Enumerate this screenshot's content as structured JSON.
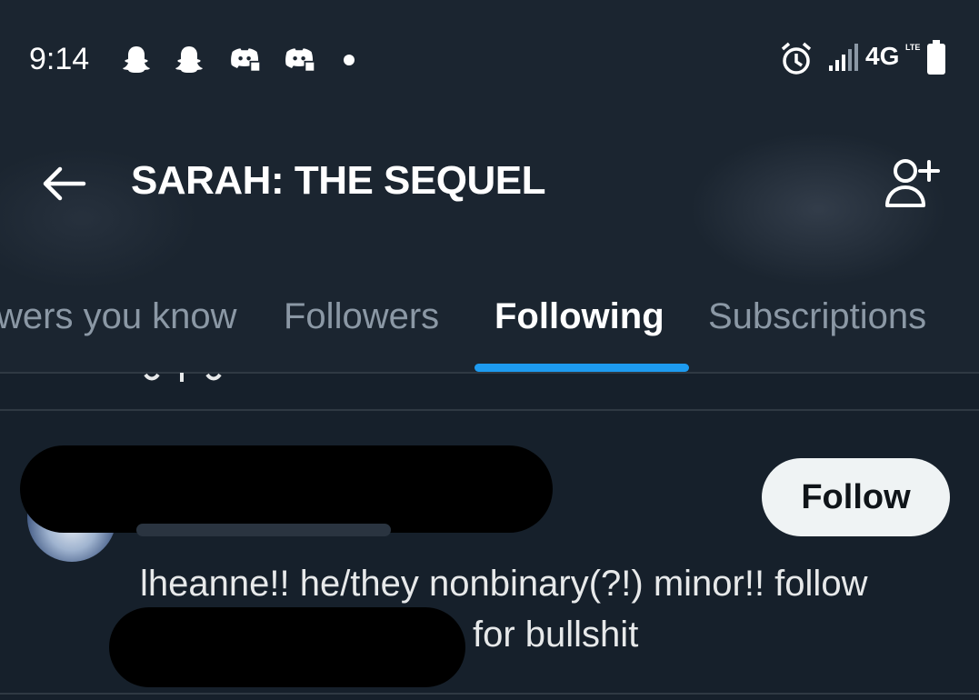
{
  "status_bar": {
    "time": "9:14",
    "network": "4G",
    "network_sub": "LTE",
    "notification_icons": [
      "snapchat-icon",
      "snapchat-icon",
      "discord-icon",
      "discord-icon"
    ],
    "system_icons": [
      "alarm-icon",
      "signal-icon",
      "battery-icon"
    ]
  },
  "header": {
    "title": "SARAH: THE SEQUEL",
    "back_icon": "arrow-left-icon",
    "add_user_icon": "add-user-icon"
  },
  "tabs": [
    {
      "label": "Followers you know",
      "visible_label": "wers you know",
      "active": false
    },
    {
      "label": "Followers",
      "active": false
    },
    {
      "label": "Following",
      "active": true
    },
    {
      "label": "Subscriptions",
      "active": false
    }
  ],
  "user_card": {
    "follow_label": "Follow",
    "bio_line1": "lheanne!! he/they nonbinary(?!) minor!! follow",
    "bio_line2": "for bullshit"
  },
  "colors": {
    "background": "#16202b",
    "accent": "#1d9bf0",
    "muted_text": "#8b98a5",
    "button_bg": "#eff3f4"
  }
}
